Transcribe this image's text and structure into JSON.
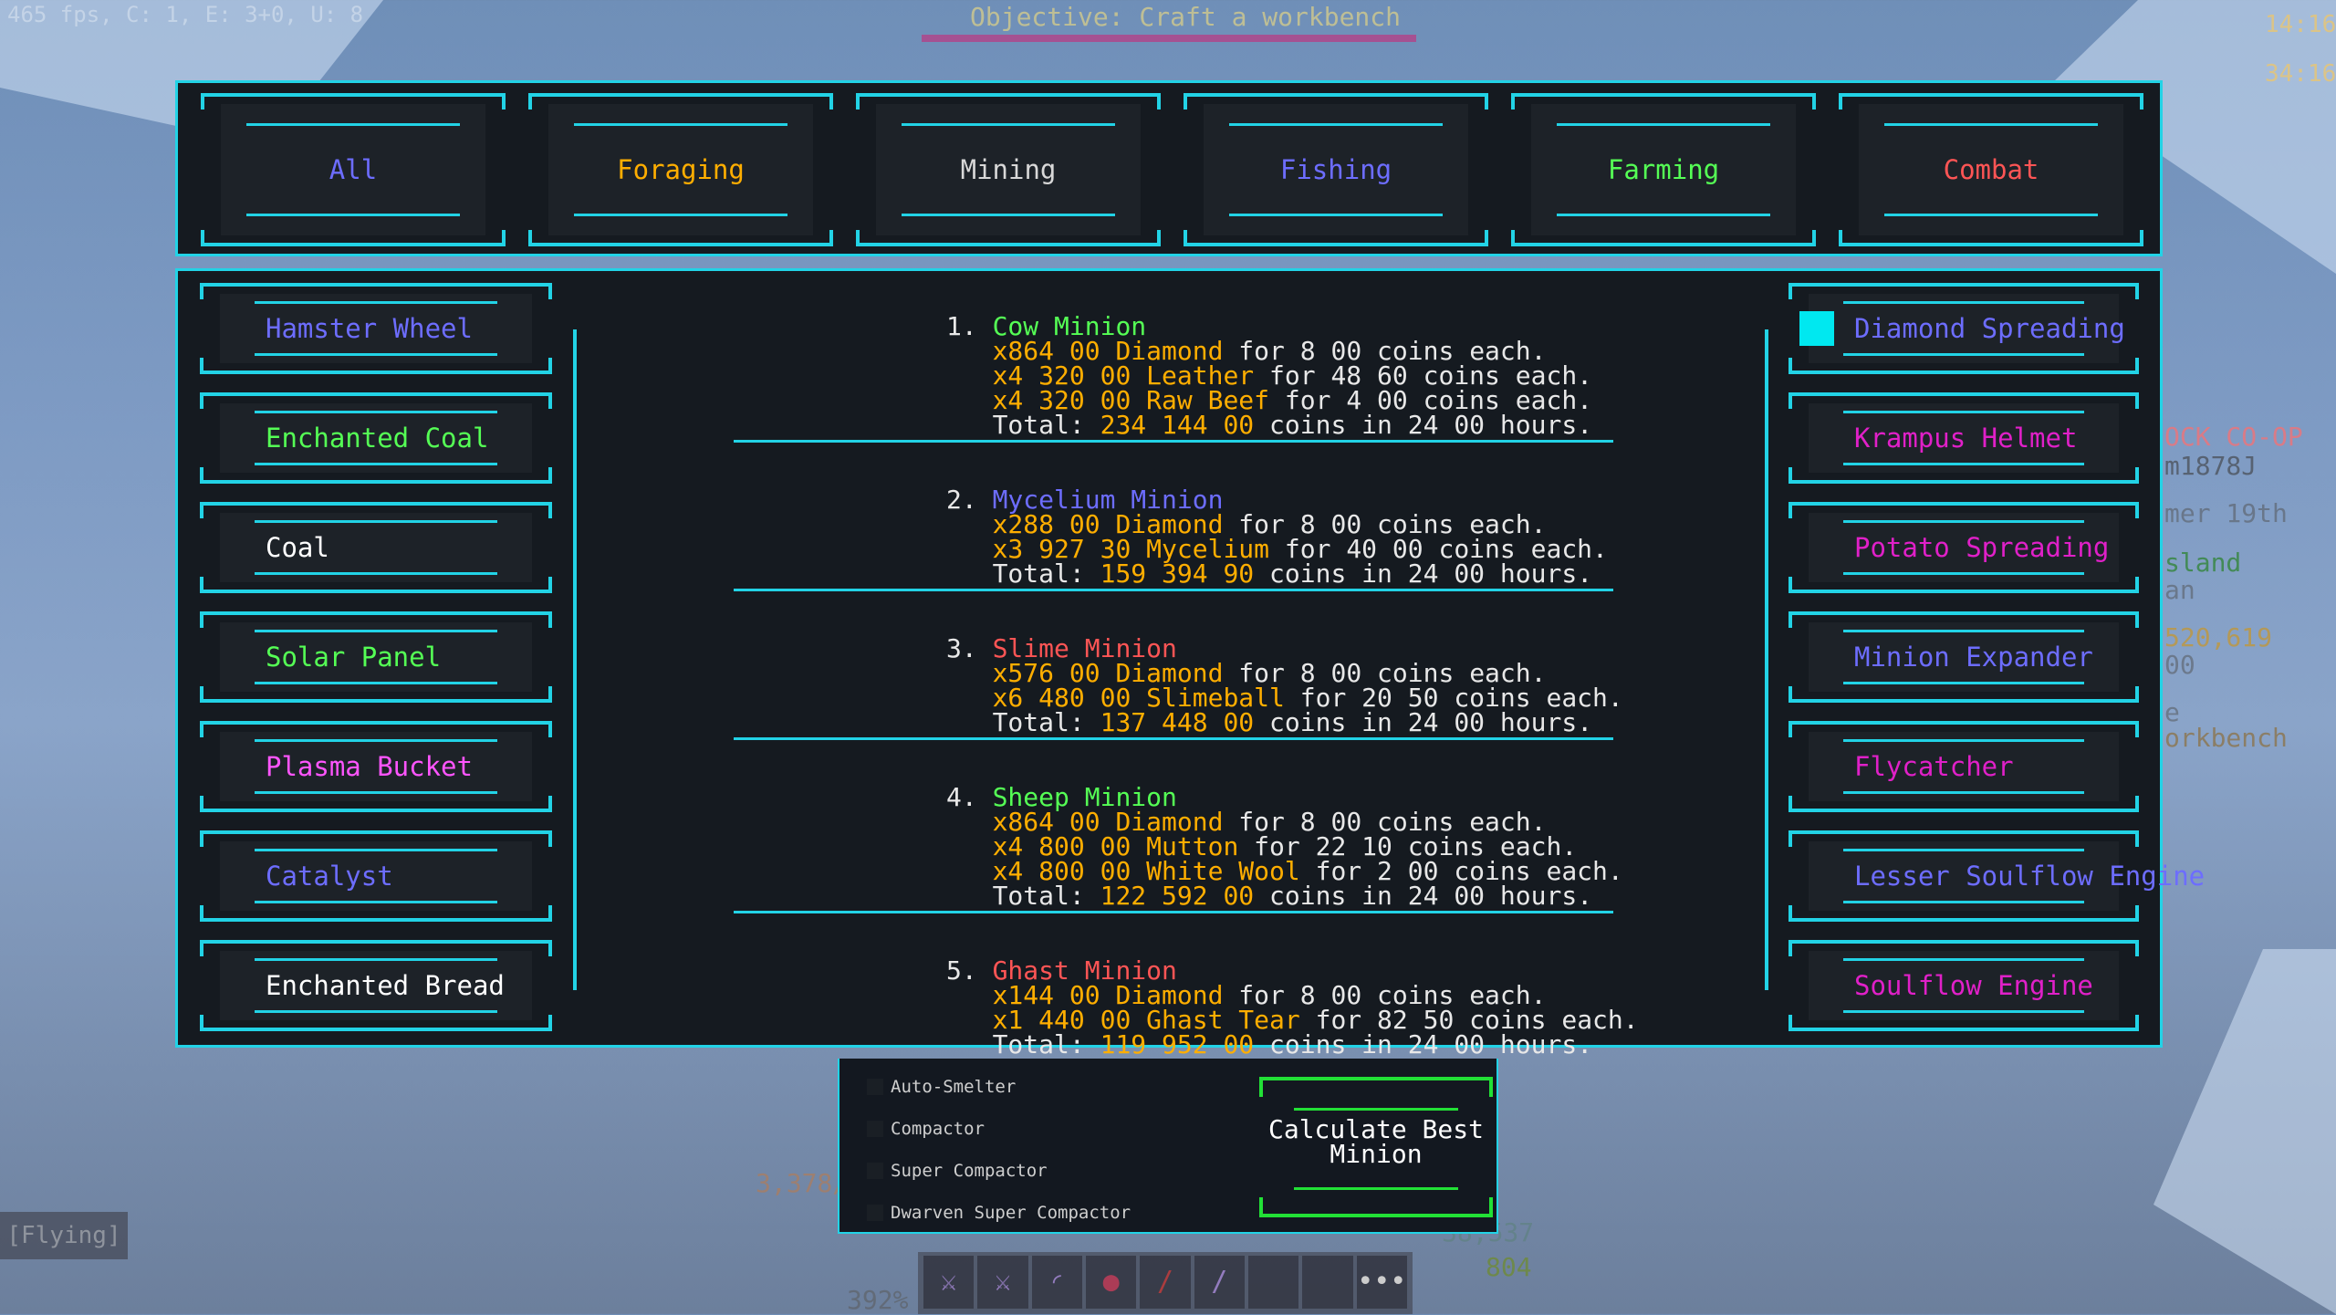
{
  "hud": {
    "fps": "465 fps, C: 1, E: 3+0, U: 8",
    "objective": "Objective: Craft a workbench",
    "time1": "14:16",
    "time2": "34:16",
    "side_text": [
      "OCK CO-OP",
      "m1878J",
      "mer 19th",
      "sland",
      "an",
      "520,619",
      "00",
      "e",
      "orkbench"
    ],
    "flying": "[Flying]",
    "left_num": "3,378/",
    "right_num1": "38,537",
    "right_num2": "804",
    "percent": "392%"
  },
  "tabs": [
    {
      "label": "All",
      "color": "#6d6dff"
    },
    {
      "label": "Foraging",
      "color": "#ffae00"
    },
    {
      "label": "Mining",
      "color": "#d8d8d8"
    },
    {
      "label": "Fishing",
      "color": "#6d6dff"
    },
    {
      "label": "Farming",
      "color": "#55ff55"
    },
    {
      "label": "Combat",
      "color": "#ff5555"
    }
  ],
  "left_list": [
    {
      "label": "Hamster Wheel",
      "color": "#6d6dff"
    },
    {
      "label": "Enchanted Coal",
      "color": "#55ff55"
    },
    {
      "label": "Coal",
      "color": "#ffffff"
    },
    {
      "label": "Solar Panel",
      "color": "#55ff55"
    },
    {
      "label": "Plasma Bucket",
      "color": "#ff55ff"
    },
    {
      "label": "Catalyst",
      "color": "#6d6dff"
    },
    {
      "label": "Enchanted Bread",
      "color": "#ffffff"
    }
  ],
  "right_list": [
    {
      "label": "Diamond Spreading",
      "color": "#6d6dff",
      "checked": true
    },
    {
      "label": "Krampus Helmet",
      "color": "#e020c8",
      "checked": false
    },
    {
      "label": "Potato Spreading",
      "color": "#e020c8",
      "checked": false
    },
    {
      "label": "Minion Expander",
      "color": "#6d6dff",
      "checked": false
    },
    {
      "label": "Flycatcher",
      "color": "#e020c8",
      "checked": false
    },
    {
      "label": "Lesser Soulflow Engine",
      "color": "#6d6dff",
      "checked": false
    },
    {
      "label": "Soulflow Engine",
      "color": "#e020c8",
      "checked": false
    }
  ],
  "results": [
    {
      "rank": "1.",
      "name": "Cow Minion",
      "name_color": "#55ff55",
      "items": [
        {
          "qty": "x864 00 Diamond",
          "price": "8 00"
        },
        {
          "qty": "x4 320 00 Leather",
          "price": "48 60"
        },
        {
          "qty": "x4 320 00 Raw Beef",
          "price": "4 00"
        }
      ],
      "total": "234 144 00",
      "hours": "24 00"
    },
    {
      "rank": "2.",
      "name": "Mycelium Minion",
      "name_color": "#6d6dff",
      "items": [
        {
          "qty": "x288 00 Diamond",
          "price": "8 00"
        },
        {
          "qty": "x3 927 30 Mycelium",
          "price": "40 00"
        }
      ],
      "total": "159 394 90",
      "hours": "24 00"
    },
    {
      "rank": "3.",
      "name": "Slime Minion",
      "name_color": "#ff5555",
      "items": [
        {
          "qty": "x576 00 Diamond",
          "price": "8 00"
        },
        {
          "qty": "x6 480 00 Slimeball",
          "price": "20 50"
        }
      ],
      "total": "137 448 00",
      "hours": "24 00"
    },
    {
      "rank": "4.",
      "name": "Sheep Minion",
      "name_color": "#55ff55",
      "items": [
        {
          "qty": "x864 00 Diamond",
          "price": "8 00"
        },
        {
          "qty": "x4 800 00 Mutton",
          "price": "22 10"
        },
        {
          "qty": "x4 800 00 White Wool",
          "price": "2 00"
        }
      ],
      "total": "122 592 00",
      "hours": "24 00"
    },
    {
      "rank": "5.",
      "name": "Ghast Minion",
      "name_color": "#ff5555",
      "items": [
        {
          "qty": "x144 00 Diamond",
          "price": "8 00"
        },
        {
          "qty": "x1 440 00 Ghast Tear",
          "price": "82 50"
        }
      ],
      "total": "119 952 00",
      "hours": "24 00"
    }
  ],
  "words": {
    "for": " for ",
    "coins_each": " coins each.",
    "total": "Total: ",
    "coins_in": " coins in ",
    "hours": " hours."
  },
  "upgrades": [
    "Auto-Smelter",
    "Compactor",
    "Super Compactor",
    "Dwarven Super Compactor"
  ],
  "calculate_button": {
    "line1": "Calculate Best",
    "line2": "Minion"
  },
  "hotbar_icons": [
    "sword-icon",
    "sword-icon",
    "bow-icon",
    "orb-icon",
    "rod-icon",
    "wand-icon",
    "empty",
    "empty",
    "menu-icon"
  ]
}
